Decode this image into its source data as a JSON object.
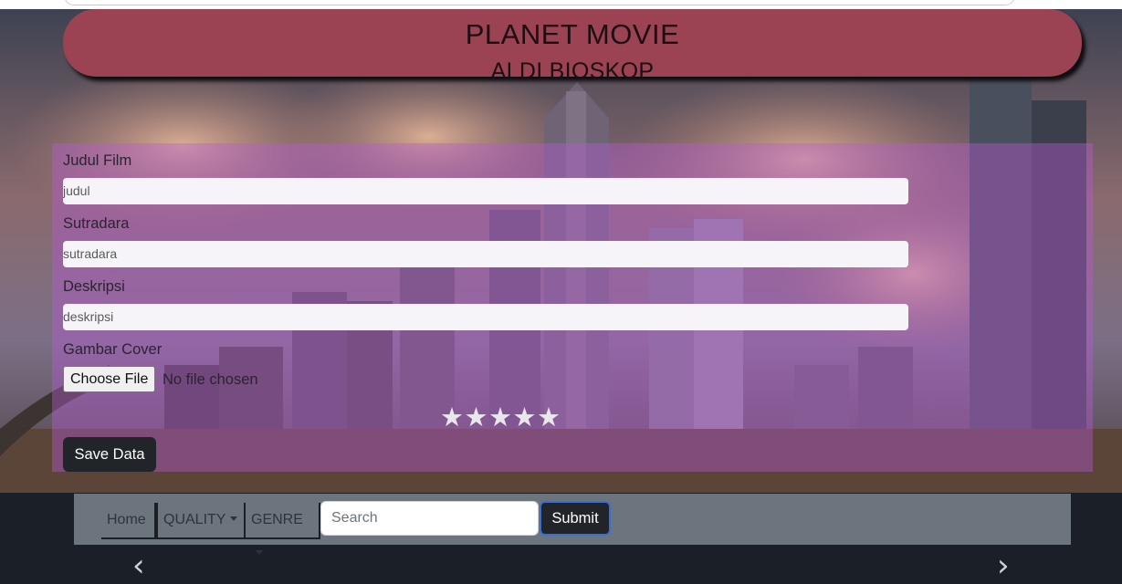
{
  "header": {
    "title": "PLANET MOVIE",
    "subtitle": "ALDI BIOSKOP"
  },
  "form": {
    "fields": [
      {
        "label": "Judul Film",
        "placeholder": "judul"
      },
      {
        "label": "Sutradara",
        "placeholder": "sutradara"
      },
      {
        "label": "Deskripsi",
        "placeholder": "deskripsi"
      }
    ],
    "cover_label": "Gambar Cover",
    "file_button": "Choose File",
    "file_status": "No file chosen",
    "rating": {
      "value": 0,
      "max": 5
    },
    "save_label": "Save Data"
  },
  "navbar": {
    "home": "Home",
    "quality": "QUALITY",
    "genre": "GENRE",
    "search_placeholder": "Search",
    "submit_label": "Submit"
  },
  "carousel": {
    "prev_icon": "chevron-left-icon",
    "next_icon": "chevron-right-icon"
  },
  "colors": {
    "header": "#9b4352",
    "panel": "#b45ad2",
    "navbar": "#6c757d",
    "button": "#212529"
  }
}
